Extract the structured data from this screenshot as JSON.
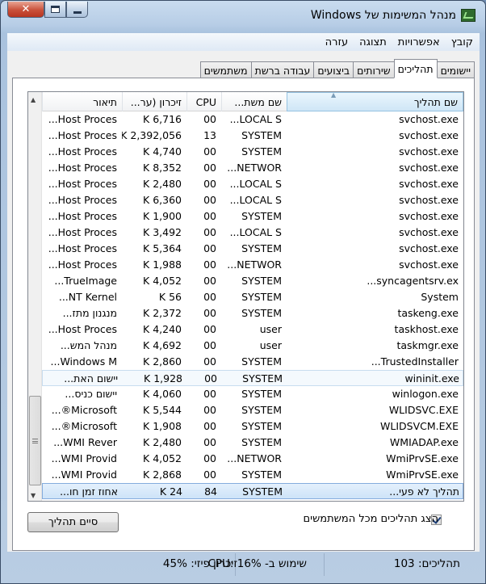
{
  "window": {
    "title": "מנהל המשימות של Windows",
    "close_glyph": "✕"
  },
  "menu": [
    "קובץ",
    "אפשרויות",
    "תצוגה",
    "עזרה"
  ],
  "tabs": [
    {
      "label": "יישומים",
      "active": false
    },
    {
      "label": "תהליכים",
      "active": true
    },
    {
      "label": "שירותים",
      "active": false
    },
    {
      "label": "ביצועים",
      "active": false
    },
    {
      "label": "עבודה ברשת",
      "active": false
    },
    {
      "label": "משתמשים",
      "active": false
    }
  ],
  "columns": [
    "שם תהליך",
    "שם משת...",
    "CPU",
    "זיכרון (ער...",
    "תיאור"
  ],
  "rows": [
    [
      "svchost.exe",
      "LOCAL S...",
      "00",
      "6,716 K",
      "Host Proces..."
    ],
    [
      "svchost.exe",
      "SYSTEM",
      "13",
      "2,392,056 K",
      "Host Proces..."
    ],
    [
      "svchost.exe",
      "SYSTEM",
      "00",
      "4,740 K",
      "Host Proces..."
    ],
    [
      "svchost.exe",
      "NETWOR...",
      "00",
      "8,352 K",
      "Host Proces..."
    ],
    [
      "svchost.exe",
      "LOCAL S...",
      "00",
      "2,480 K",
      "Host Proces..."
    ],
    [
      "svchost.exe",
      "LOCAL S...",
      "00",
      "6,360 K",
      "Host Proces..."
    ],
    [
      "svchost.exe",
      "SYSTEM",
      "00",
      "1,900 K",
      "Host Proces..."
    ],
    [
      "svchost.exe",
      "LOCAL S...",
      "00",
      "3,492 K",
      "Host Proces..."
    ],
    [
      "svchost.exe",
      "SYSTEM",
      "00",
      "5,364 K",
      "Host Proces..."
    ],
    [
      "svchost.exe",
      "NETWOR...",
      "00",
      "1,988 K",
      "Host Proces..."
    ],
    [
      "syncagentsrv.ex...",
      "SYSTEM",
      "00",
      "4,052 K",
      "TrueImage..."
    ],
    [
      "System",
      "SYSTEM",
      "00",
      "56 K",
      "NT Kernel..."
    ],
    [
      "taskeng.exe",
      "SYSTEM",
      "00",
      "2,372 K",
      "מנגנון מתז..."
    ],
    [
      "taskhost.exe",
      "user",
      "00",
      "4,240 K",
      "Host Proces..."
    ],
    [
      "taskmgr.exe",
      "user",
      "00",
      "4,692 K",
      "מנהל המש..."
    ],
    [
      "TrustedInstaller...",
      "SYSTEM",
      "00",
      "2,860 K",
      "Windows M..."
    ],
    [
      "wininit.exe",
      "SYSTEM",
      "00",
      "1,928 K",
      "יישום האת..."
    ],
    [
      "winlogon.exe",
      "SYSTEM",
      "00",
      "4,060 K",
      "יישום כניס..."
    ],
    [
      "WLIDSVC.EXE",
      "SYSTEM",
      "00",
      "5,544 K",
      "Microsoft®..."
    ],
    [
      "WLIDSVCM.EXE",
      "SYSTEM",
      "00",
      "1,908 K",
      "Microsoft®..."
    ],
    [
      "WMIADAP.exe",
      "SYSTEM",
      "00",
      "2,480 K",
      "WMI Rever..."
    ],
    [
      "WmiPrvSE.exe",
      "NETWOR...",
      "00",
      "4,052 K",
      "WMI Provid..."
    ],
    [
      "WmiPrvSE.exe",
      "SYSTEM",
      "00",
      "2,868 K",
      "WMI Provid..."
    ],
    [
      "תהליך לא פעי...",
      "SYSTEM",
      "84",
      "24 K",
      "אחוז זמן חו..."
    ]
  ],
  "show_all_users": {
    "label": "הצג תהליכים מכל המשתמשים",
    "checked": true
  },
  "end_process_button": "סיים תהליך",
  "status": {
    "processes": "תהליכים: 103",
    "cpu": "שימוש ב- CPU: 16%",
    "memory": "זיכרון פיזי: 45%"
  }
}
